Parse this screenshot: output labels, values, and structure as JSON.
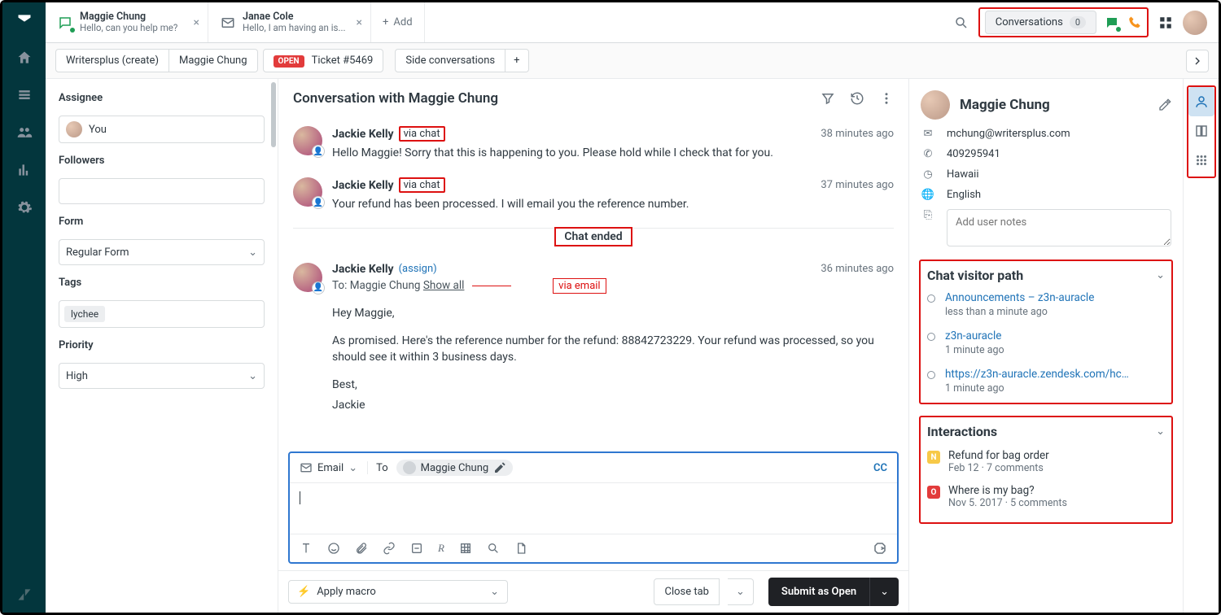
{
  "topbar": {
    "tabs": [
      {
        "title": "Maggie Chung",
        "subtitle": "Hello, can you help me?"
      },
      {
        "title": "Janae Cole",
        "subtitle": "Hello, I am having an is..."
      }
    ],
    "add_label": "Add",
    "conversations_label": "Conversations",
    "conversations_count": "0"
  },
  "subheader": {
    "org": "Writersplus (create)",
    "requester": "Maggie Chung",
    "status": "OPEN",
    "ticket": "Ticket #5469",
    "side_conversations": "Side conversations"
  },
  "leftpanel": {
    "assignee_label": "Assignee",
    "assignee_value": "You",
    "followers_label": "Followers",
    "form_label": "Form",
    "form_value": "Regular Form",
    "tags_label": "Tags",
    "tag_value": "lychee",
    "priority_label": "Priority",
    "priority_value": "High"
  },
  "center": {
    "title": "Conversation with Maggie Chung",
    "messages": [
      {
        "author": "Jackie Kelly",
        "via": "via chat",
        "time": "38 minutes ago",
        "body": "Hello Maggie! Sorry that this is happening to you. Please hold while I check that for you."
      },
      {
        "author": "Jackie Kelly",
        "via": "via chat",
        "time": "37 minutes ago",
        "body": "Your refund has been processed. I will email you the reference number."
      }
    ],
    "chat_ended": "Chat ended",
    "email_msg": {
      "author": "Jackie Kelly",
      "assign": "(assign)",
      "to_label": "To:",
      "to_name": "Maggie Chung",
      "show_all": "Show all",
      "via_email": "via email",
      "time": "36 minutes ago",
      "greeting": "Hey Maggie,",
      "body": "As promised. Here's the reference number for the refund: 88842723229. Your refund was processed, so you should see it within 3 business days.",
      "closing1": "Best,",
      "closing2": "Jackie"
    },
    "composer": {
      "channel": "Email",
      "to_label": "To",
      "recipient": "Maggie Chung",
      "cc": "CC"
    },
    "footer": {
      "macro": "Apply macro",
      "close_tab": "Close tab",
      "submit": "Submit as Open"
    }
  },
  "rightpanel": {
    "name": "Maggie Chung",
    "email": "mchung@writersplus.com",
    "phone": "409295941",
    "location": "Hawaii",
    "language": "English",
    "notes_placeholder": "Add user notes",
    "visitor_path_title": "Chat visitor path",
    "visitor_items": [
      {
        "title": "Announcements – z3n-auracle",
        "sub": "less than a minute ago"
      },
      {
        "title": "z3n-auracle",
        "sub": "1 minute ago"
      },
      {
        "title": "https://z3n-auracle.zendesk.com/hc/en...",
        "sub": "1 minute ago"
      }
    ],
    "interactions_title": "Interactions",
    "interactions": [
      {
        "title": "Refund for bag order",
        "sub": "Feb 12 · 7 comments",
        "color": "yellow",
        "letter": "N"
      },
      {
        "title": "Where is my bag?",
        "sub": "Nov 5. 2017 · 5 comments",
        "color": "red",
        "letter": "O"
      }
    ]
  }
}
